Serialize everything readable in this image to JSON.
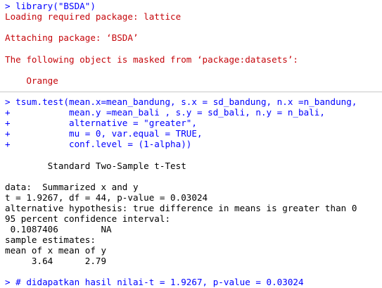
{
  "console": {
    "lines": [
      "> library(\"BSDA\")",
      "Loading required package: lattice",
      "Attaching package: ‘BSDA’",
      "The following object is masked from ‘package:datasets’:",
      "    Orange",
      "> tsum.test(mean.x=mean_bandung, s.x = sd_bandung, n.x =n_bandung,",
      "+           mean.y =mean_bali , s.y = sd_bali, n.y = n_bali,",
      "+           alternative = \"greater\",",
      "+           mu = 0, var.equal = TRUE,",
      "+           conf.level = (1-alpha))",
      "        Standard Two-Sample t-Test",
      "data:  Summarized x and y",
      "t = 1.9267, df = 44, p-value = 0.03024",
      "alternative hypothesis: true difference in means is greater than 0",
      "95 percent confidence interval:",
      " 0.1087406        NA",
      "sample estimates:",
      "mean of x mean of y",
      "     3.64      2.79",
      "> # didapatkan hasil nilai-t = 1.9267, p-value = 0.03024"
    ]
  }
}
